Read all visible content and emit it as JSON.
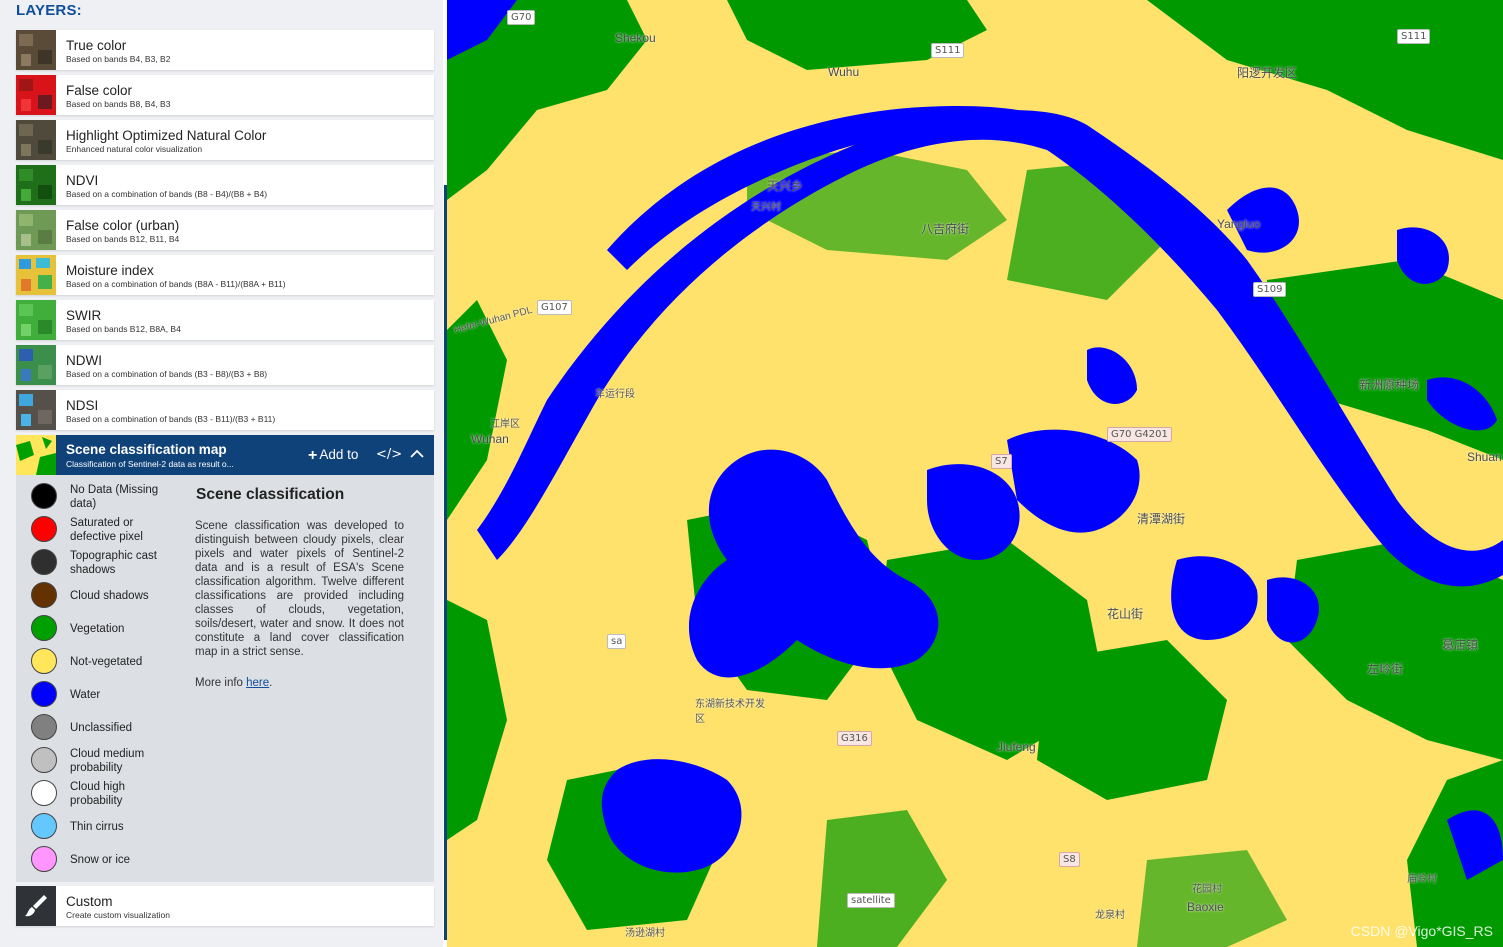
{
  "panel": {
    "title": "LAYERS:",
    "layers": [
      {
        "name": "True color",
        "desc": "Based on bands B4, B3, B2",
        "icon": "true-color-thumbnail"
      },
      {
        "name": "False color",
        "desc": "Based on bands B8, B4, B3",
        "icon": "false-color-thumbnail"
      },
      {
        "name": "Highlight Optimized Natural Color",
        "desc": "Enhanced natural color visualization",
        "icon": "natural-color-thumbnail"
      },
      {
        "name": "NDVI",
        "desc": "Based on a combination of bands (B8 - B4)/(B8 + B4)",
        "icon": "ndvi-thumbnail"
      },
      {
        "name": "False color (urban)",
        "desc": "Based on bands B12, B11, B4",
        "icon": "urban-thumbnail"
      },
      {
        "name": "Moisture index",
        "desc": "Based on a combination of bands (B8A - B11)/(B8A + B11)",
        "icon": "moisture-thumbnail"
      },
      {
        "name": "SWIR",
        "desc": "Based on bands B12, B8A, B4",
        "icon": "swir-thumbnail"
      },
      {
        "name": "NDWI",
        "desc": "Based on a combination of bands (B3 - B8)/(B3 + B8)",
        "icon": "ndwi-thumbnail"
      },
      {
        "name": "NDSI",
        "desc": "Based on a combination of bands (B3 - B11)/(B3 + B11)",
        "icon": "ndsi-thumbnail"
      }
    ],
    "active": {
      "name": "Scene classification map",
      "desc": "Classification of Sentinel-2 data as result o...",
      "add_to": "Add to",
      "code": "</>",
      "legend": [
        {
          "label": "No Data (Missing data)",
          "color": "#000000"
        },
        {
          "label": "Saturated or defective pixel",
          "color": "#ff0000"
        },
        {
          "label": "Topographic cast shadows",
          "color": "#2f2f2f"
        },
        {
          "label": "Cloud shadows",
          "color": "#643200"
        },
        {
          "label": "Vegetation",
          "color": "#00a000"
        },
        {
          "label": "Not-vegetated",
          "color": "#ffe65a"
        },
        {
          "label": "Water",
          "color": "#0000ff"
        },
        {
          "label": "Unclassified",
          "color": "#808080"
        },
        {
          "label": "Cloud medium probability",
          "color": "#c0c0c0"
        },
        {
          "label": "Cloud high probability",
          "color": "#ffffff"
        },
        {
          "label": "Thin cirrus",
          "color": "#64c8ff"
        },
        {
          "label": "Snow or ice",
          "color": "#ff96ff"
        }
      ],
      "info_title": "Scene classification",
      "info_text": "Scene classification was developed to distinguish between cloudy pixels, clear pixels and water pixels of Sentinel-2 data and is a result of ESA's Scene classification algorithm. Twelve different classifications are provided including classes of clouds, vegetation, soils/desert, water and snow. It does not constitute a land cover classification map in a strict sense.",
      "more_info_prefix": "More info ",
      "more_info_link": "here",
      "more_info_suffix": "."
    },
    "custom": {
      "name": "Custom",
      "desc": "Create custom visualization",
      "icon": "paintbrush-icon"
    }
  },
  "map": {
    "roads": [
      "G70",
      "S111",
      "S111",
      "G107",
      "S109",
      "G70 G4201",
      "S7",
      "G316",
      "S8",
      "sa",
      "satellite"
    ],
    "places": [
      "Shekou",
      "Wuhu",
      "阳逻开发区",
      "天兴乡",
      "天兴村",
      "八吉府街",
      "Yangluo",
      "江岸区",
      "Wuhan",
      "Hefei-Wuhan PDL",
      "车运行段",
      "清潭湖街",
      "花山街",
      "新洲原种场",
      "葛店镇",
      "左岭街",
      "东湖新技术开发区",
      "Jiufeng",
      "Baoxie",
      "汤逊湖村",
      "Shuan",
      "龙泉村",
      "花园村",
      "庙岭村"
    ],
    "watermark": "CSDN @Vigo*GIS_RS"
  }
}
